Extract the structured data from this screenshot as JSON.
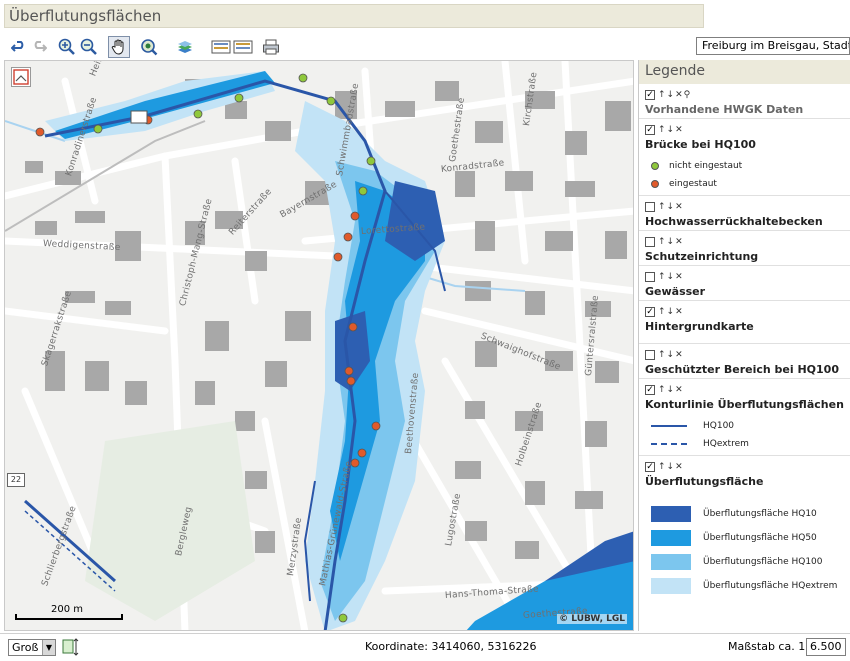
{
  "app": {
    "title": "Überflutungsflächen",
    "place": "Freiburg im Breisgau, Stadt"
  },
  "toolbar": {
    "icons": [
      "undo-icon",
      "redo-icon",
      "zoom-in-icon",
      "zoom-out-icon",
      "pan-hand-icon",
      "zoom-region-icon",
      "layers-icon",
      "legend-icon",
      "legend-alt-icon",
      "print-icon"
    ]
  },
  "map": {
    "scale_text": "200 m",
    "copyright": "© LUBW, LGL",
    "route_badge": "22",
    "streets": [
      "Heiligestraße",
      "Konradinerstraße",
      "Schwimmbadstraße",
      "Goethestraße",
      "Kirchstraße",
      "Konradstraße",
      "Christoph-Mang-Straße",
      "Reiterstraße",
      "Bayernstraße",
      "Lorettostraße",
      "Weddigenstraße",
      "Skagerrakstraße",
      "Schwaighofstraße",
      "Güntersralstraße",
      "Beethovenstraße",
      "Holbeinstraße",
      "Lugostraße",
      "Merzystraße",
      "Mathias-Grünewald-Straße",
      "Bergleweg",
      "Schlierbergstraße",
      "Hans-Thoma-Straße",
      "Goethestraße"
    ]
  },
  "legend": {
    "title": "Legende",
    "sections": [
      {
        "name": "Vorhandene HWGK Daten",
        "checked": "✓",
        "grey": true
      },
      {
        "name": "Brücke bei HQ100",
        "checked": "✓",
        "items": [
          {
            "label": "nicht eingestaut",
            "color": "#8fc83c"
          },
          {
            "label": "eingestaut",
            "color": "#e05a2b"
          }
        ]
      },
      {
        "name": "Hochwasserrückhaltebecken",
        "checked": ""
      },
      {
        "name": "Schutzeinrichtung",
        "checked": ""
      },
      {
        "name": "Gewässer",
        "checked": ""
      },
      {
        "name": "Hintergrundkarte",
        "checked": "✓"
      },
      {
        "name": "Geschützter Bereich bei HQ100",
        "checked": ""
      },
      {
        "name": "Konturlinie Überflutungsflächen",
        "checked": "✓",
        "lines": [
          {
            "label": "HQ100",
            "style": "solid",
            "color": "#2a56a8"
          },
          {
            "label": "HQextrem",
            "style": "dashed",
            "color": "#2a56a8"
          }
        ]
      },
      {
        "name": "Überflutungsfläche",
        "checked": "✓",
        "boxes": [
          {
            "label": "Überflutungsfläche HQ10",
            "color": "#2d5fb2"
          },
          {
            "label": "Überflutungsfläche HQ50",
            "color": "#1e9ae0"
          },
          {
            "label": "Überflutungsfläche HQ100",
            "color": "#7cc6ee"
          },
          {
            "label": "Überflutungsfläche HQextrem",
            "color": "#c2e3f6"
          }
        ]
      }
    ]
  },
  "status": {
    "size_label": "Groß",
    "coord_text": "Koordinate: 3414060, 5316226",
    "scale_label": "Maßstab ca. 1:",
    "scale_value": "6.500"
  }
}
